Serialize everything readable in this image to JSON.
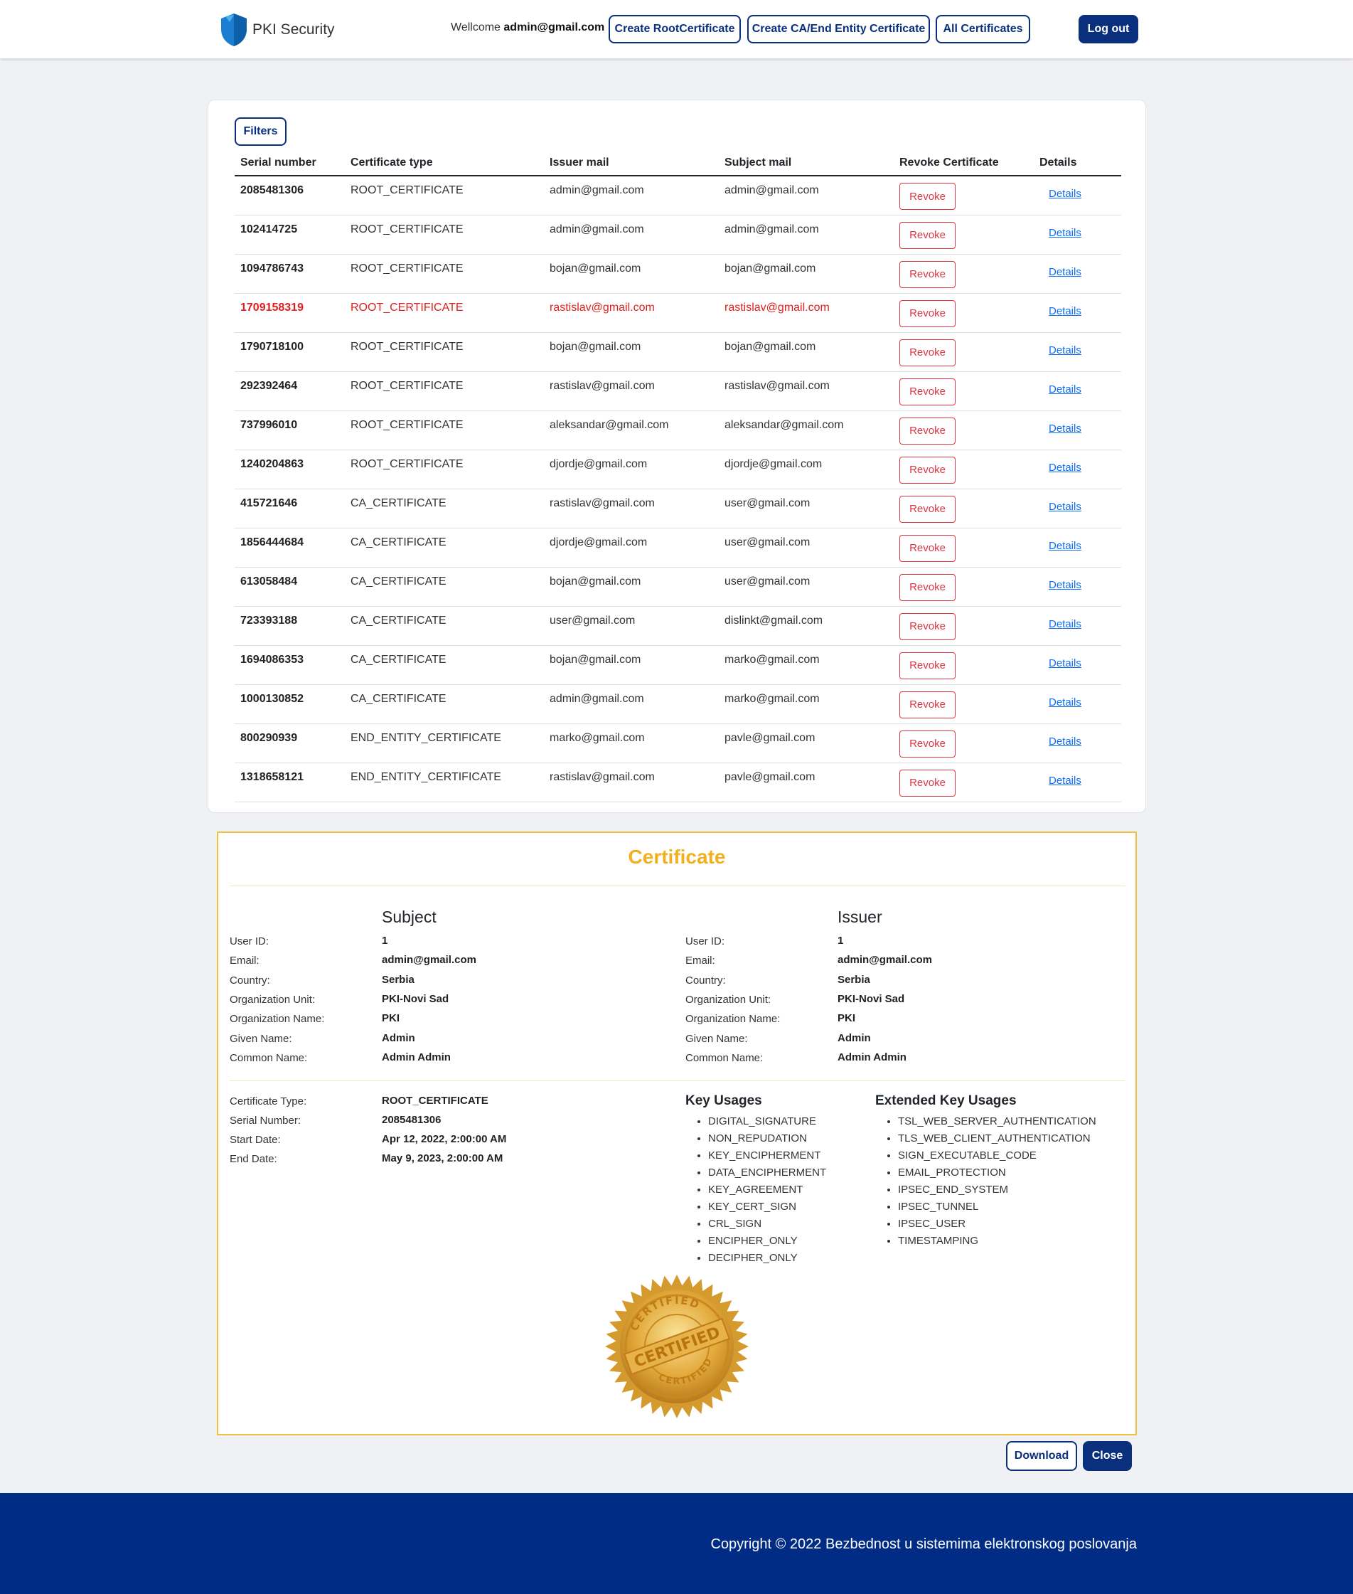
{
  "nav": {
    "brand": "PKI Security",
    "welcome_prefix": "Wellcome",
    "welcome_user": "admin@gmail.com",
    "create_root": "Create RootCertificate",
    "create_ca": "Create CA/End Entity Certificate",
    "all_certs": "All Certificates",
    "logout": "Log out"
  },
  "colors": {
    "primary": "#0a2f7d",
    "revoke": "#dc3545",
    "revoked_row": "#e02020",
    "certificate_accent": "#f2b01e",
    "footer": "#002c86"
  },
  "table": {
    "filters_label": "Filters",
    "headers": [
      "Serial number",
      "Certificate type",
      "Issuer mail",
      "Subject mail",
      "Revoke Certificate",
      "Details"
    ],
    "revoke_label": "Revoke",
    "details_label": "Details",
    "rows": [
      {
        "serial": "2085481306",
        "type": "ROOT_CERTIFICATE",
        "issuer": "admin@gmail.com",
        "subject": "admin@gmail.com",
        "revoked": false
      },
      {
        "serial": "102414725",
        "type": "ROOT_CERTIFICATE",
        "issuer": "admin@gmail.com",
        "subject": "admin@gmail.com",
        "revoked": false
      },
      {
        "serial": "1094786743",
        "type": "ROOT_CERTIFICATE",
        "issuer": "bojan@gmail.com",
        "subject": "bojan@gmail.com",
        "revoked": false
      },
      {
        "serial": "1709158319",
        "type": "ROOT_CERTIFICATE",
        "issuer": "rastislav@gmail.com",
        "subject": "rastislav@gmail.com",
        "revoked": true
      },
      {
        "serial": "1790718100",
        "type": "ROOT_CERTIFICATE",
        "issuer": "bojan@gmail.com",
        "subject": "bojan@gmail.com",
        "revoked": false
      },
      {
        "serial": "292392464",
        "type": "ROOT_CERTIFICATE",
        "issuer": "rastislav@gmail.com",
        "subject": "rastislav@gmail.com",
        "revoked": false
      },
      {
        "serial": "737996010",
        "type": "ROOT_CERTIFICATE",
        "issuer": "aleksandar@gmail.com",
        "subject": "aleksandar@gmail.com",
        "revoked": false
      },
      {
        "serial": "1240204863",
        "type": "ROOT_CERTIFICATE",
        "issuer": "djordje@gmail.com",
        "subject": "djordje@gmail.com",
        "revoked": false
      },
      {
        "serial": "415721646",
        "type": "CA_CERTIFICATE",
        "issuer": "rastislav@gmail.com",
        "subject": "user@gmail.com",
        "revoked": false
      },
      {
        "serial": "1856444684",
        "type": "CA_CERTIFICATE",
        "issuer": "djordje@gmail.com",
        "subject": "user@gmail.com",
        "revoked": false
      },
      {
        "serial": "613058484",
        "type": "CA_CERTIFICATE",
        "issuer": "bojan@gmail.com",
        "subject": "user@gmail.com",
        "revoked": false
      },
      {
        "serial": "723393188",
        "type": "CA_CERTIFICATE",
        "issuer": "user@gmail.com",
        "subject": "dislinkt@gmail.com",
        "revoked": false
      },
      {
        "serial": "1694086353",
        "type": "CA_CERTIFICATE",
        "issuer": "bojan@gmail.com",
        "subject": "marko@gmail.com",
        "revoked": false
      },
      {
        "serial": "1000130852",
        "type": "CA_CERTIFICATE",
        "issuer": "admin@gmail.com",
        "subject": "marko@gmail.com",
        "revoked": false
      },
      {
        "serial": "800290939",
        "type": "END_ENTITY_CERTIFICATE",
        "issuer": "marko@gmail.com",
        "subject": "pavle@gmail.com",
        "revoked": false
      },
      {
        "serial": "1318658121",
        "type": "END_ENTITY_CERTIFICATE",
        "issuer": "rastislav@gmail.com",
        "subject": "pavle@gmail.com",
        "revoked": false
      }
    ]
  },
  "certificate": {
    "title": "Certificate",
    "subject_heading": "Subject",
    "issuer_heading": "Issuer",
    "field_labels": [
      "User ID:",
      "Email:",
      "Country:",
      "Organization Unit:",
      "Organization Name:",
      "Given Name:",
      "Common Name:"
    ],
    "subject_values": [
      "1",
      "admin@gmail.com",
      "Serbia",
      "PKI-Novi Sad",
      "PKI",
      "Admin",
      "Admin Admin"
    ],
    "issuer_values": [
      "1",
      "admin@gmail.com",
      "Serbia",
      "PKI-Novi Sad",
      "PKI",
      "Admin",
      "Admin Admin"
    ],
    "meta_labels": [
      "Certificate Type:",
      "Serial Number:",
      "Start Date:",
      "End Date:"
    ],
    "meta_values": [
      "ROOT_CERTIFICATE",
      "2085481306",
      "Apr 12, 2022, 2:00:00 AM",
      "May 9, 2023, 2:00:00 AM"
    ],
    "key_usages_heading": "Key Usages",
    "key_usages": [
      "DIGITAL_SIGNATURE",
      "NON_REPUDATION",
      "KEY_ENCIPHERMENT",
      "DATA_ENCIPHERMENT",
      "KEY_AGREEMENT",
      "KEY_CERT_SIGN",
      "CRL_SIGN",
      "ENCIPHER_ONLY",
      "DECIPHER_ONLY"
    ],
    "ext_key_usages_heading": "Extended Key Usages",
    "ext_key_usages": [
      "TSL_WEB_SERVER_AUTHENTICATION",
      "TLS_WEB_CLIENT_AUTHENTICATION",
      "SIGN_EXECUTABLE_CODE",
      "EMAIL_PROTECTION",
      "IPSEC_END_SYSTEM",
      "IPSEC_TUNNEL",
      "IPSEC_USER",
      "TIMESTAMPING"
    ],
    "seal_text_main": "CERTIFIED",
    "seal_text_ring": "CERTIFIED"
  },
  "actions": {
    "download": "Download",
    "close": "Close"
  },
  "footer": {
    "copyright": "Copyright © 2022 Bezbednost u sistemima elektronskog poslovanja"
  }
}
